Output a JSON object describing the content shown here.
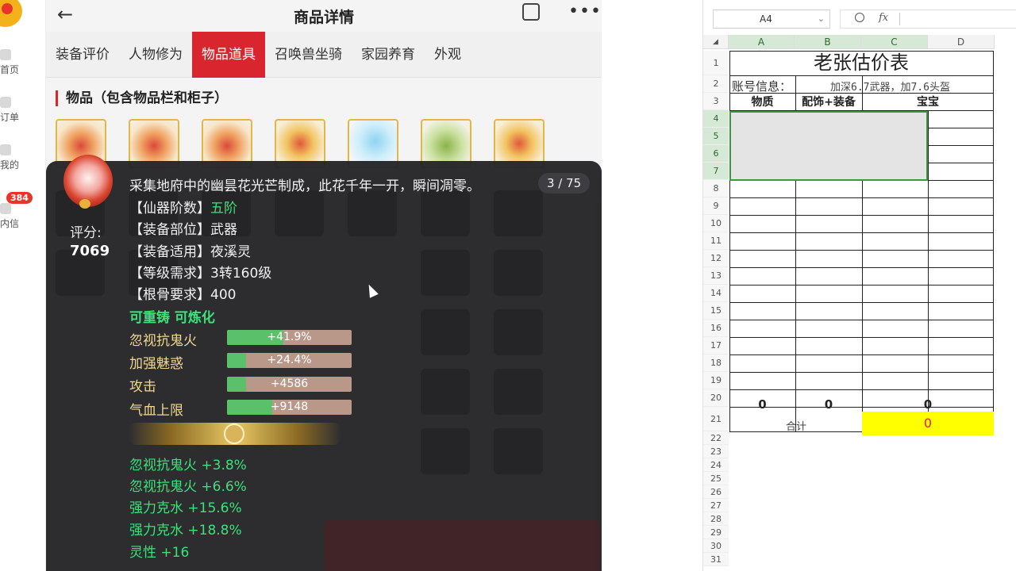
{
  "sidebar": {
    "items": [
      {
        "label": "首页",
        "icon": "home-icon"
      },
      {
        "label": "订单",
        "icon": "order-icon"
      },
      {
        "label": "我的",
        "icon": "user-icon"
      },
      {
        "label": "内信",
        "icon": "mail-icon"
      }
    ],
    "badge": "384"
  },
  "header": {
    "title": "商品详情",
    "back_icon": "back-arrow-icon",
    "share_icon": "share-icon",
    "more_icon": "more-icon"
  },
  "tabs": [
    {
      "label": "装备评价",
      "active": false
    },
    {
      "label": "人物修为",
      "active": false
    },
    {
      "label": "物品道具",
      "active": true
    },
    {
      "label": "召唤兽坐骑",
      "active": false
    },
    {
      "label": "家园养育",
      "active": false
    },
    {
      "label": "外观",
      "active": false
    }
  ],
  "section": {
    "title": "物品（包含物品栏和柜子）"
  },
  "item_detail": {
    "description": "采集地府中的幽昙花光芒制成，此花千年一开，瞬间凋零。",
    "pager": "3 / 75",
    "score_label": "评分:",
    "score_value": "7069",
    "attributes": [
      {
        "label": "【仙器阶数】",
        "value": "五阶",
        "highlight": true
      },
      {
        "label": "【装备部位】",
        "value": "武器",
        "highlight": false
      },
      {
        "label": "【装备适用】",
        "value": "夜溪灵",
        "highlight": false
      },
      {
        "label": "【等级需求】",
        "value": "3转160级",
        "highlight": false
      },
      {
        "label": "【根骨要求】",
        "value": "400",
        "highlight": false
      }
    ],
    "forge_status": "可重铸 可炼化",
    "stats": [
      {
        "name": "忽视抗鬼火",
        "value": "+41.9%",
        "fill": 0.45
      },
      {
        "name": "加强魅惑",
        "value": "+24.4%",
        "fill": 0.15
      },
      {
        "name": "攻击",
        "value": "+4586",
        "fill": 0.15
      },
      {
        "name": "气血上限",
        "value": "+9148",
        "fill": 0.36
      }
    ],
    "extra_stats": [
      "忽视抗鬼火 +3.8%",
      "忽视抗鬼火 +6.6%",
      "强力克水 +15.6%",
      "强力克水 +18.8%",
      "灵性 +16"
    ]
  },
  "spreadsheet": {
    "name_box": "A4",
    "fx_label": "fx",
    "columns": [
      "A",
      "B",
      "C",
      "D"
    ],
    "rows": [
      "1",
      "2",
      "3",
      "4",
      "5",
      "6",
      "7",
      "8",
      "9",
      "10",
      "11",
      "12",
      "13",
      "14",
      "15",
      "16",
      "17",
      "18",
      "19",
      "20",
      "21",
      "22",
      "23",
      "24",
      "25",
      "26",
      "27",
      "28",
      "29",
      "30",
      "31"
    ],
    "title": "老张估价表",
    "account_label": "账号信息：",
    "account_value": "加深6.7武器，加7.6头盔",
    "headers": [
      "物质",
      "配饰+装备",
      "宝宝"
    ],
    "totals_row": [
      "0",
      "0",
      "0"
    ],
    "sum_label": "合计",
    "sum_value": "0",
    "colors": {
      "highlight": "#ffff00",
      "sum_text": "#e02020",
      "selection": "#3c9a3c"
    }
  }
}
